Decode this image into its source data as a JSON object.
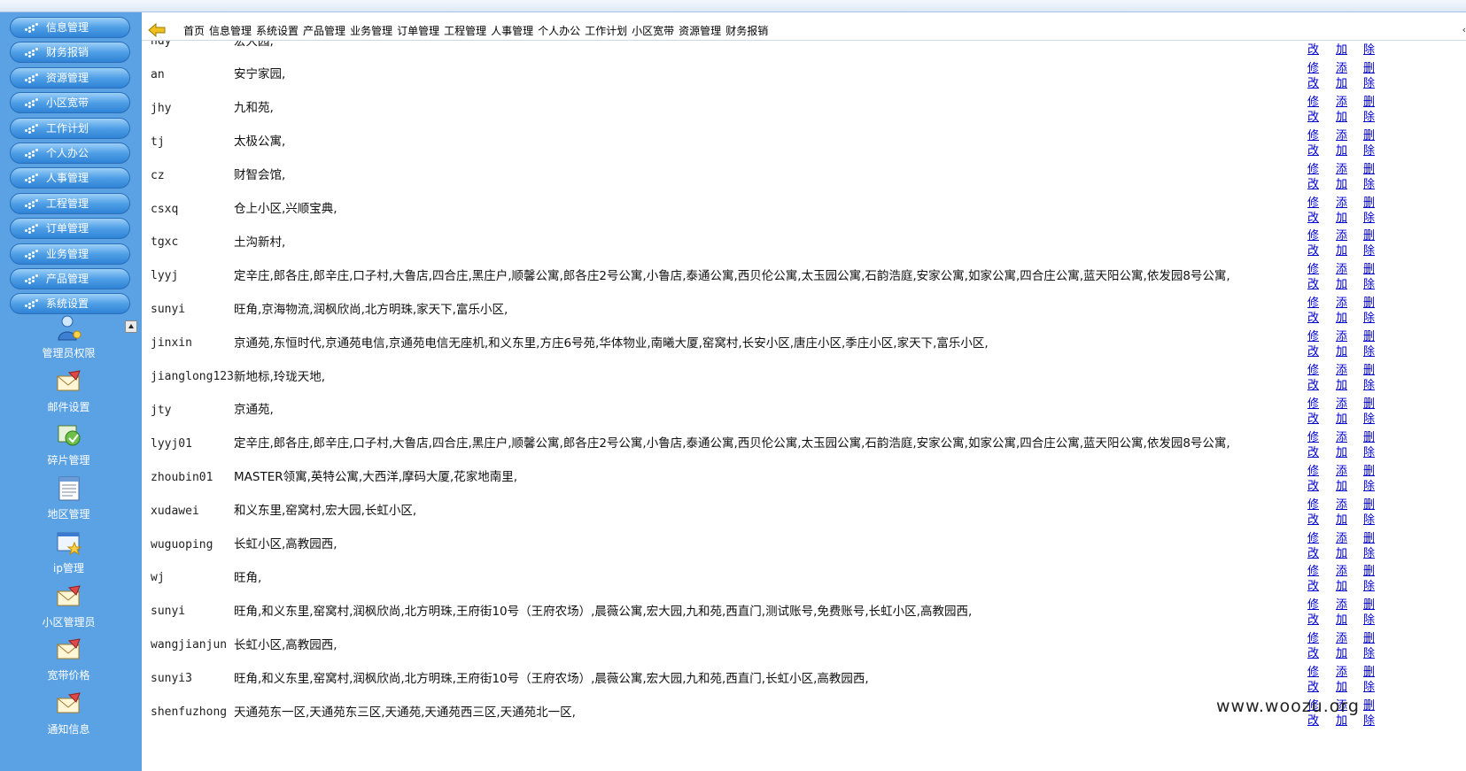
{
  "sidebar": {
    "menu": [
      {
        "label": "信息管理"
      },
      {
        "label": "财务报销"
      },
      {
        "label": "资源管理"
      },
      {
        "label": "小区宽带"
      },
      {
        "label": "工作计划"
      },
      {
        "label": "个人办公"
      },
      {
        "label": "人事管理"
      },
      {
        "label": "工程管理"
      },
      {
        "label": "订单管理"
      },
      {
        "label": "业务管理"
      },
      {
        "label": "产品管理"
      },
      {
        "label": "系统设置"
      }
    ],
    "tools": [
      {
        "label": "管理员权限",
        "icon": "admin-user-icon"
      },
      {
        "label": "邮件设置",
        "icon": "mail-icon"
      },
      {
        "label": "碎片管理",
        "icon": "fragment-icon"
      },
      {
        "label": "地区管理",
        "icon": "document-icon"
      },
      {
        "label": "ip管理",
        "icon": "window-icon"
      },
      {
        "label": "小区管理员",
        "icon": "mail-icon"
      },
      {
        "label": "宽带价格",
        "icon": "mail-icon"
      },
      {
        "label": "通知信息",
        "icon": "mail-icon"
      }
    ]
  },
  "nav": {
    "links": [
      "首页",
      "信息管理",
      "系统设置",
      "产品管理",
      "业务管理",
      "订单管理",
      "工程管理",
      "人事管理",
      "个人办公",
      "工作计划",
      "小区宽带",
      "资源管理",
      "财务报销"
    ],
    "right_mark": "‹"
  },
  "actions": {
    "edit": "修改",
    "add": "添加",
    "delete": "删除"
  },
  "rows": [
    {
      "user": "hdy",
      "areas": "宏大园,"
    },
    {
      "user": "an",
      "areas": "安宁家园,"
    },
    {
      "user": "jhy",
      "areas": "九和苑,"
    },
    {
      "user": "tj",
      "areas": "太极公寓,"
    },
    {
      "user": "cz",
      "areas": "财智会馆,"
    },
    {
      "user": "csxq",
      "areas": "仓上小区,兴顺宝典,"
    },
    {
      "user": "tgxc",
      "areas": "土沟新村,"
    },
    {
      "user": "lyyj",
      "areas": "定辛庄,郎各庄,郎辛庄,口子村,大鲁店,四合庄,黑庄户,顺馨公寓,郎各庄2号公寓,小鲁店,泰通公寓,西贝伦公寓,太玉园公寓,石韵浩庭,安家公寓,如家公寓,四合庄公寓,蓝天阳公寓,依发园8号公寓,"
    },
    {
      "user": "sunyi",
      "areas": "旺角,京海物流,润枫欣尚,北方明珠,家天下,富乐小区,"
    },
    {
      "user": "jinxin",
      "areas": "京通苑,东恒时代,京通苑电信,京通苑电信无座机,和义东里,方庄6号苑,华体物业,南曦大厦,窑窝村,长安小区,唐庄小区,季庄小区,家天下,富乐小区,"
    },
    {
      "user": "jianglong123",
      "areas": "新地标,玲珑天地,"
    },
    {
      "user": "jty",
      "areas": "京通苑,"
    },
    {
      "user": "lyyj01",
      "areas": "定辛庄,郎各庄,郎辛庄,口子村,大鲁店,四合庄,黑庄户,顺馨公寓,郎各庄2号公寓,小鲁店,泰通公寓,西贝伦公寓,太玉园公寓,石韵浩庭,安家公寓,如家公寓,四合庄公寓,蓝天阳公寓,依发园8号公寓,"
    },
    {
      "user": "zhoubin01",
      "areas": "MASTER领寓,英特公寓,大西洋,摩码大厦,花家地南里,"
    },
    {
      "user": "xudawei",
      "areas": "和义东里,窑窝村,宏大园,长虹小区,"
    },
    {
      "user": "wuguoping",
      "areas": "长虹小区,高教园西,"
    },
    {
      "user": "wj",
      "areas": "旺角,"
    },
    {
      "user": "sunyi",
      "areas": "旺角,和义东里,窑窝村,润枫欣尚,北方明珠,王府街10号（王府农场）,晨薇公寓,宏大园,九和苑,西直门,测试账号,免费账号,长虹小区,高教园西,"
    },
    {
      "user": "wangjianjun",
      "areas": "长虹小区,高教园西,"
    },
    {
      "user": "sunyi3",
      "areas": "旺角,和义东里,窑窝村,润枫欣尚,北方明珠,王府街10号（王府农场）,晨薇公寓,宏大园,九和苑,西直门,长虹小区,高教园西,"
    },
    {
      "user": "shenfuzhong",
      "areas": "天通苑东一区,天通苑东三区,天通苑,天通苑西三区,天通苑北一区,"
    }
  ],
  "watermark": "www.woozu.org",
  "colors": {
    "sidebar_bg": "#5aa2e3",
    "link": "#0000cc"
  }
}
